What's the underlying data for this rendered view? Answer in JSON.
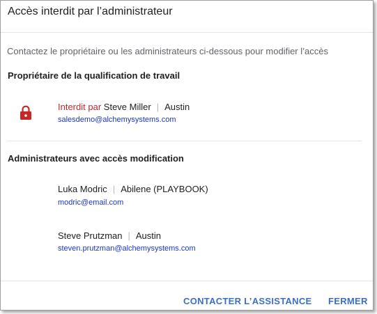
{
  "dialog": {
    "title": "Accès interdit par l’administrateur",
    "subtitle": "Contactez le propriétaire ou les administrateurs ci-dessous pour modifier l’accès"
  },
  "owner_section": {
    "heading": "Propriétaire de la qualification de travail",
    "icon": "lock-icon",
    "icon_color": "#c62828",
    "forbidden_label": "Interdit par",
    "name": "Steve Miller",
    "location": "Austin",
    "email": "salesdemo@alchemysystems.com"
  },
  "admins_section": {
    "heading": "Administrateurs avec accès modification",
    "admins": [
      {
        "name": "Luka Modric",
        "location": "Abilene (PLAYBOOK)",
        "email": "modric@email.com"
      },
      {
        "name": "Steve Prutzman",
        "location": "Austin",
        "email": "steven.prutzman@alchemysystems.com"
      }
    ]
  },
  "actions": {
    "contact_support": "CONTACTER L’ASSISTANCE",
    "close": "FERMER"
  },
  "colors": {
    "accent": "#3b6fc6",
    "link": "#1a37c9",
    "danger": "#c62828"
  }
}
